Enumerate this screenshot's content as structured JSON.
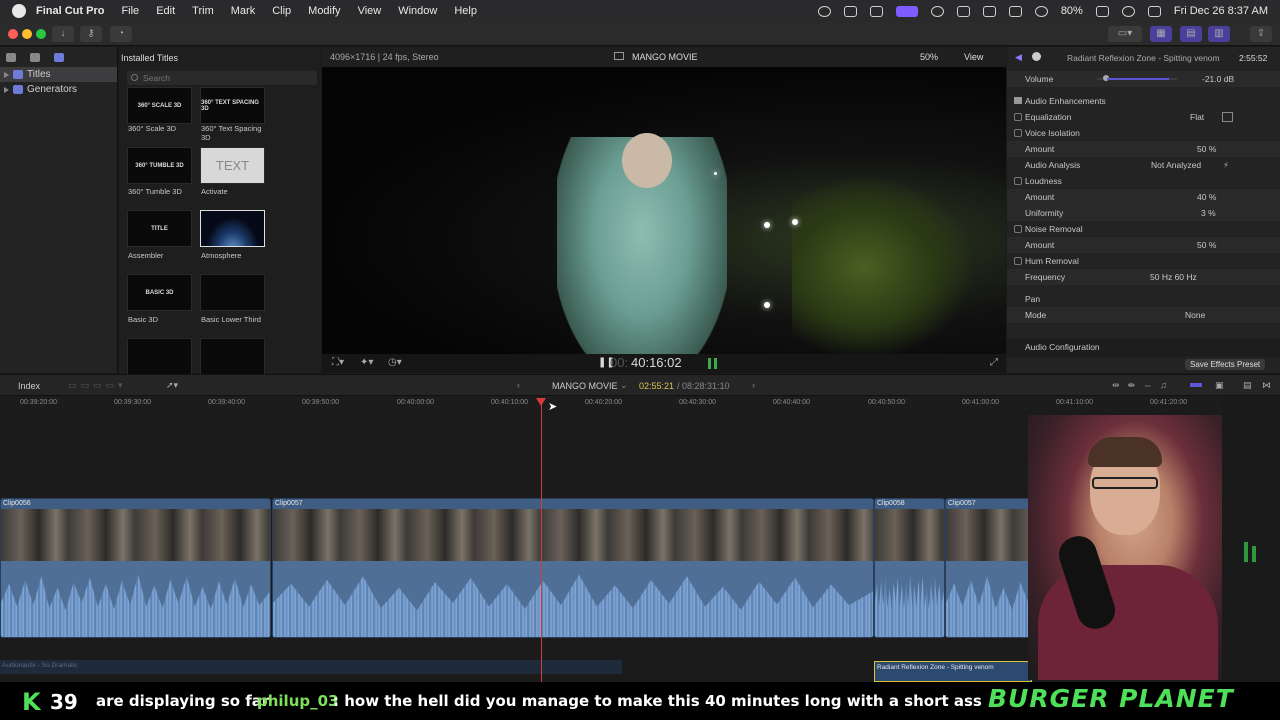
{
  "menubar": {
    "app_name": "Final Cut Pro",
    "items": [
      "File",
      "Edit",
      "Trim",
      "Mark",
      "Clip",
      "Modify",
      "View",
      "Window",
      "Help"
    ],
    "battery": "80%",
    "datetime": "Fri Dec 26  8:37 AM"
  },
  "library": {
    "items": [
      {
        "label": "Titles",
        "selected": true
      },
      {
        "label": "Generators",
        "selected": false
      }
    ]
  },
  "browser": {
    "header": "Installed Titles",
    "search_placeholder": "Search",
    "thumbs": [
      {
        "label": "360° Scale 3D",
        "thumb_text": "360° SCALE 3D"
      },
      {
        "label": "360° Text Spacing 3D",
        "thumb_text": "360° TEXT SPACING 3D"
      },
      {
        "label": "360° Tumble 3D",
        "thumb_text": "360° TUMBLE 3D"
      },
      {
        "label": "Activate",
        "thumb_text": "TEXT"
      },
      {
        "label": "Assembler",
        "thumb_text": "TITLE"
      },
      {
        "label": "Atmosphere",
        "thumb_text": ""
      },
      {
        "label": "Basic 3D",
        "thumb_text": "BASIC 3D"
      },
      {
        "label": "Basic Lower Third",
        "thumb_text": ""
      }
    ]
  },
  "viewer": {
    "format": "4096×1716 | 24 fps, Stereo",
    "project": "MANGO MOVIE",
    "zoom": "50%",
    "view_label": "View",
    "timecode": "40:16:02",
    "timecode_dim": "00:"
  },
  "inspector": {
    "title": "Radiant Reflexion Zone - Spitting venom",
    "duration": "2:55:52",
    "volume_label": "Volume",
    "volume_value": "-21.0 dB",
    "section": "Audio Enhancements",
    "rows": [
      {
        "label": "Equalization",
        "value": "Flat",
        "checkbox": true
      },
      {
        "label": "Voice Isolation",
        "value": "",
        "checkbox": true
      },
      {
        "label": "Amount",
        "value": "50 %",
        "checkbox": false
      },
      {
        "label": "Audio Analysis",
        "value": "Not Analyzed",
        "checkbox": false
      },
      {
        "label": "Loudness",
        "value": "",
        "checkbox": true
      },
      {
        "label": "Amount",
        "value": "40 %",
        "checkbox": false
      },
      {
        "label": "Uniformity",
        "value": "3 %",
        "checkbox": false
      },
      {
        "label": "Noise Removal",
        "value": "",
        "checkbox": true
      },
      {
        "label": "Amount",
        "value": "50 %",
        "checkbox": false
      },
      {
        "label": "Hum Removal",
        "value": "",
        "checkbox": true
      },
      {
        "label": "Frequency",
        "value": "50 Hz   60 Hz",
        "checkbox": false
      }
    ],
    "pan_label": "Pan",
    "mode_label": "Mode",
    "mode_value": "None",
    "config_label": "Audio Configuration",
    "save_preset": "Save Effects Preset"
  },
  "timeline": {
    "index_label": "Index",
    "project": "MANGO MOVIE",
    "position": "02:55:21",
    "total": "08:28:31:10",
    "ruler": [
      "00:39:20:00",
      "00:39:30:00",
      "00:39:40:00",
      "00:39:50:00",
      "00:40:00:00",
      "00:40:10:00",
      "00:40:20:00",
      "00:40:30:00",
      "00:40:40:00",
      "00:40:50:00",
      "00:41:00:00",
      "00:41:10:00",
      "00:41:20:00"
    ],
    "clips": [
      {
        "name": "Clip0056"
      },
      {
        "name": "Clip0057"
      },
      {
        "name": "Clip0058"
      },
      {
        "name": "Clip0057"
      }
    ],
    "music_left": "Audionautix - So Dramatic",
    "music_right": "Radiant Reflexion Zone - Spitting venom"
  },
  "overlay": {
    "k_letter": "K",
    "k_count": "39",
    "chat_prefix": "are displaying so far",
    "chat_user": "philup_03",
    "chat_message": ": how the hell did you manage to make this 40 minutes long with a short ass storyline",
    "brand": "BURGER PLANET"
  },
  "colors": {
    "accent": "#7c5cff",
    "playhead": "#d63a3a",
    "clip": "#3f5d83",
    "chat_user": "#7ee05a",
    "brand": "#4fe05a"
  }
}
